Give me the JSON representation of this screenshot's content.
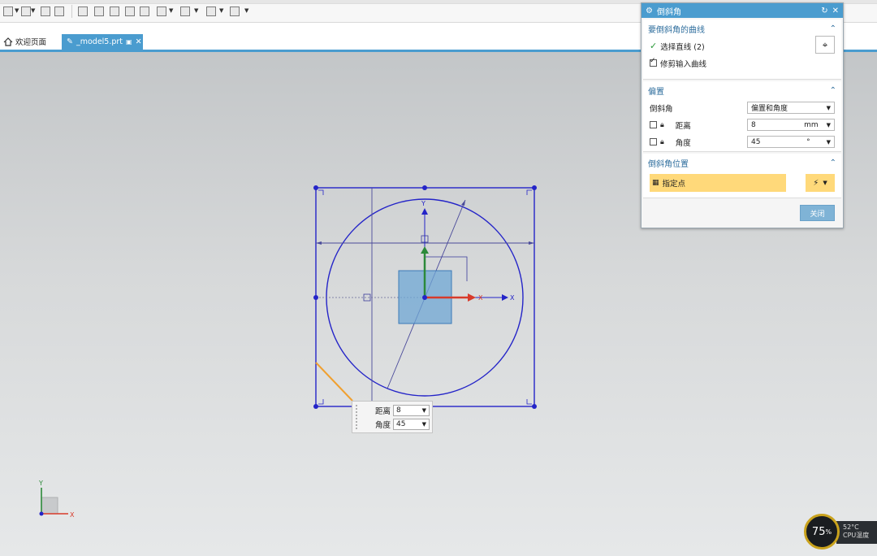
{
  "toolbar": {
    "icons": [
      "snap-icon",
      "view-icon",
      "render-icon",
      "shade-icon",
      "sketch-icon",
      "grid-icon",
      "frame-icon",
      "cube-icon",
      "layers-icon",
      "fit-icon",
      "camera-icon",
      "cylinder-icon",
      "sphere-icon"
    ]
  },
  "tabs": {
    "home_label": "欢迎页面",
    "active_label": "_model5.prt"
  },
  "dialog": {
    "title": "倒斜角",
    "section1": {
      "heading": "要倒斜角的曲线",
      "select_label": "选择直线 (2)",
      "trim_label": "修剪输入曲线",
      "trim_checked": true
    },
    "section2": {
      "heading": "偏置",
      "chamfer_label": "倒斜角",
      "chamfer_value": "偏置和角度",
      "distance_label": "距离",
      "distance_value": "8",
      "distance_unit": "mm",
      "angle_label": "角度",
      "angle_value": "45",
      "angle_unit": "°"
    },
    "section3": {
      "heading": "倒斜角位置",
      "point_label": "指定点"
    },
    "close_label": "关闭"
  },
  "float_input": {
    "distance_label": "距离",
    "distance_value": "8",
    "angle_label": "角度",
    "angle_value": "45"
  },
  "gauge": {
    "percent": "75",
    "percent_unit": "%",
    "temp": "52°C",
    "temp_label": "CPU温度"
  },
  "colors": {
    "accent": "#4a9ccf",
    "sketch": "#2424c8",
    "highlight": "#ffd97a",
    "chamfer": "#f0a030",
    "axis_x": "#d83a2a",
    "axis_y": "#2c8a3a"
  }
}
